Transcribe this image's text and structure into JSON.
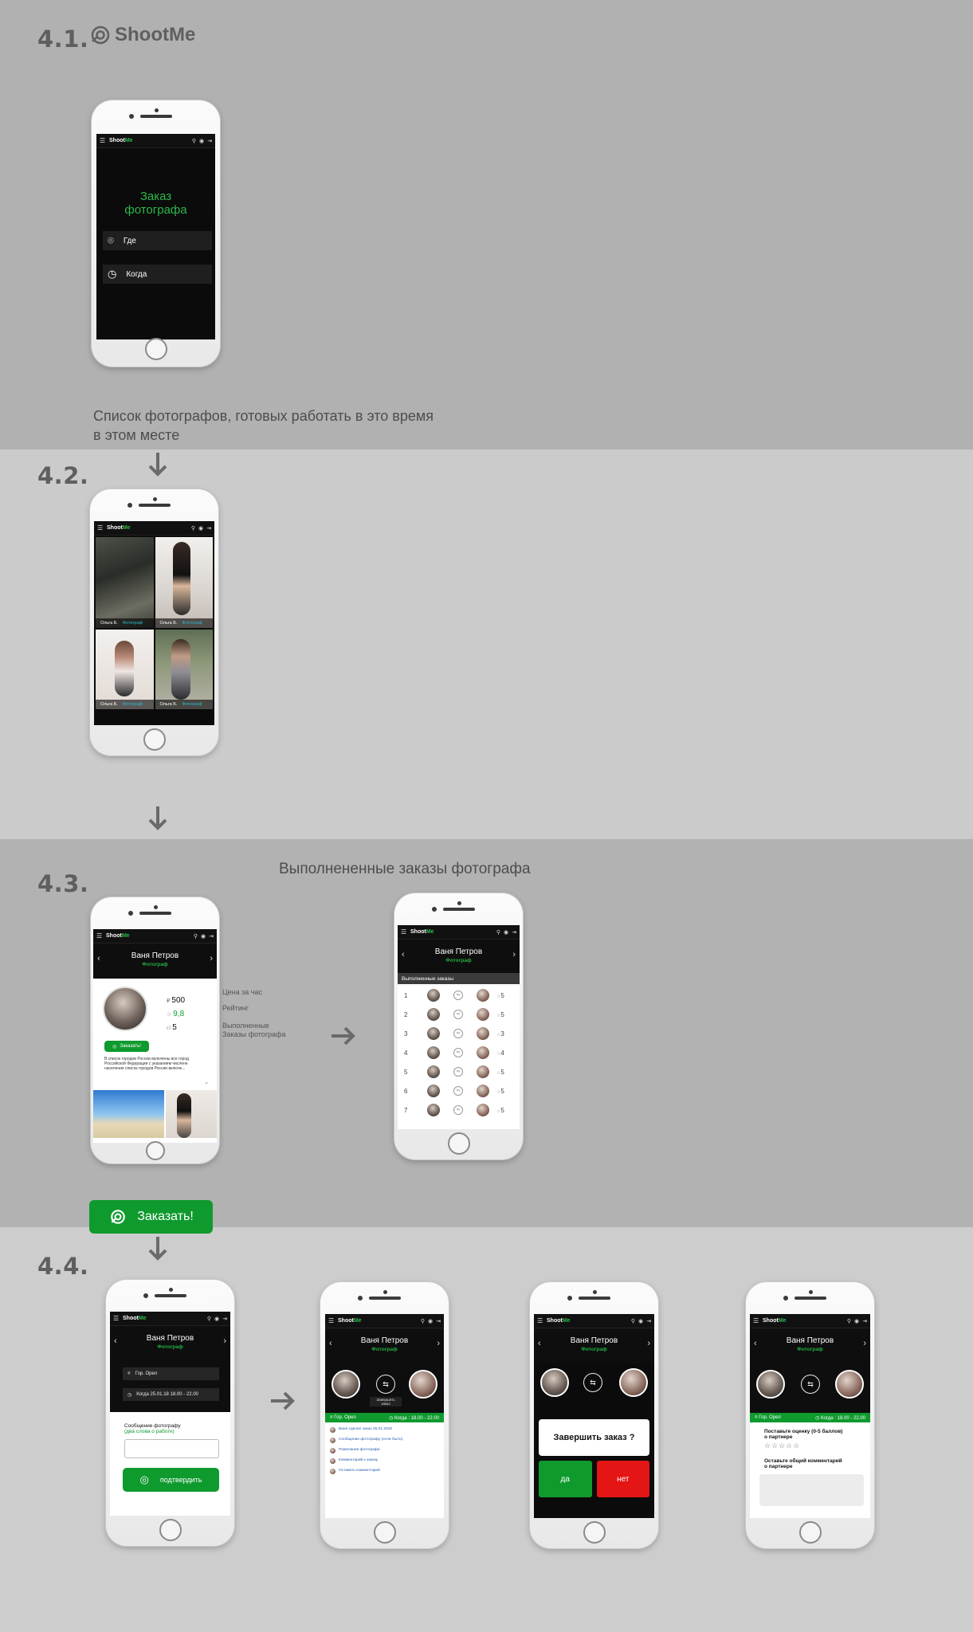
{
  "brand": {
    "name": "ShootMe",
    "accent": "#2db84a",
    "cta_green": "#0f9a2e"
  },
  "sections": {
    "s1": {
      "num": "4.1."
    },
    "s2": {
      "num": "4.2."
    },
    "s3": {
      "num": "4.3."
    },
    "s4": {
      "num": "4.4."
    }
  },
  "annotations": {
    "list_caption_1": "Список фотографов, готовых работать в это время",
    "list_caption_2": "в этом месте",
    "completed_orders_caption": "Выполнененные заказы фотографа",
    "price_label": "Цена за час",
    "rating_label": "Рейтинг",
    "done_label_1": "Выполненные",
    "done_label_2": "Заказы фотографа"
  },
  "appbar": {
    "logo_a": "Shoot",
    "logo_b": "Me"
  },
  "screen_order": {
    "title_1": "Заказ",
    "title_2": "фотографа",
    "where": "Где",
    "when": "Когда"
  },
  "screen_list": {
    "cards": [
      {
        "name": "Ольга Б.",
        "role": "Фотограф"
      },
      {
        "name": "Ольга Б.",
        "role": "Фотограф"
      },
      {
        "name": "Ольга Б.",
        "role": "Фотограф"
      },
      {
        "name": "Ольга Б.",
        "role": "Фотограф"
      }
    ]
  },
  "profile": {
    "name": "Ваня Петров",
    "role": "Фотограф",
    "price": "500",
    "rating": "9,8",
    "orders": "5",
    "order_button": "Заказать!",
    "about": "В список городов России включены все город Российской Федерации с указанием численн населения список городов России включе..."
  },
  "completed": {
    "section_title": "Выполненные заказы",
    "rows": [
      {
        "n": "1",
        "score": "5"
      },
      {
        "n": "2",
        "score": "5"
      },
      {
        "n": "3",
        "score": "3"
      },
      {
        "n": "4",
        "score": "4"
      },
      {
        "n": "5",
        "score": "5"
      },
      {
        "n": "6",
        "score": "5"
      },
      {
        "n": "7",
        "score": "5"
      }
    ]
  },
  "big_order_button": "Заказать!",
  "confirm_screen": {
    "city": "Гор. Орел",
    "time": "Когда 25.01.18 18.00 - 22.00",
    "msg_label": "Сообщение фотографу",
    "msg_hint": "(два слова о работе)",
    "confirm": "подтвердить"
  },
  "chat_screen": {
    "finish_label_1": "Завершить",
    "finish_label_2": "заказ",
    "city": "Гор. Орел",
    "time": "Когда : 18.00 - 22.00",
    "messages": [
      "Ваня сделал заказ 25.01.2018",
      "Сообщение фотографу (если было)",
      "Пожелания фотографа",
      "Комментарий к заказу",
      "Оставить комментарий"
    ]
  },
  "finish_screen": {
    "question": "Завершить заказ ?",
    "yes": "да",
    "no": "нет"
  },
  "rate_screen": {
    "city": "Гор. Орел",
    "time": "Когда : 18.00 - 22.00",
    "rate_label_1": "Поставьте оценку (0-5 баллов)",
    "rate_label_2": "о партнере",
    "stars": "☆☆☆☆☆",
    "comment_label_1": "Оставьте общий комментарий",
    "comment_label_2": "о партнере"
  }
}
